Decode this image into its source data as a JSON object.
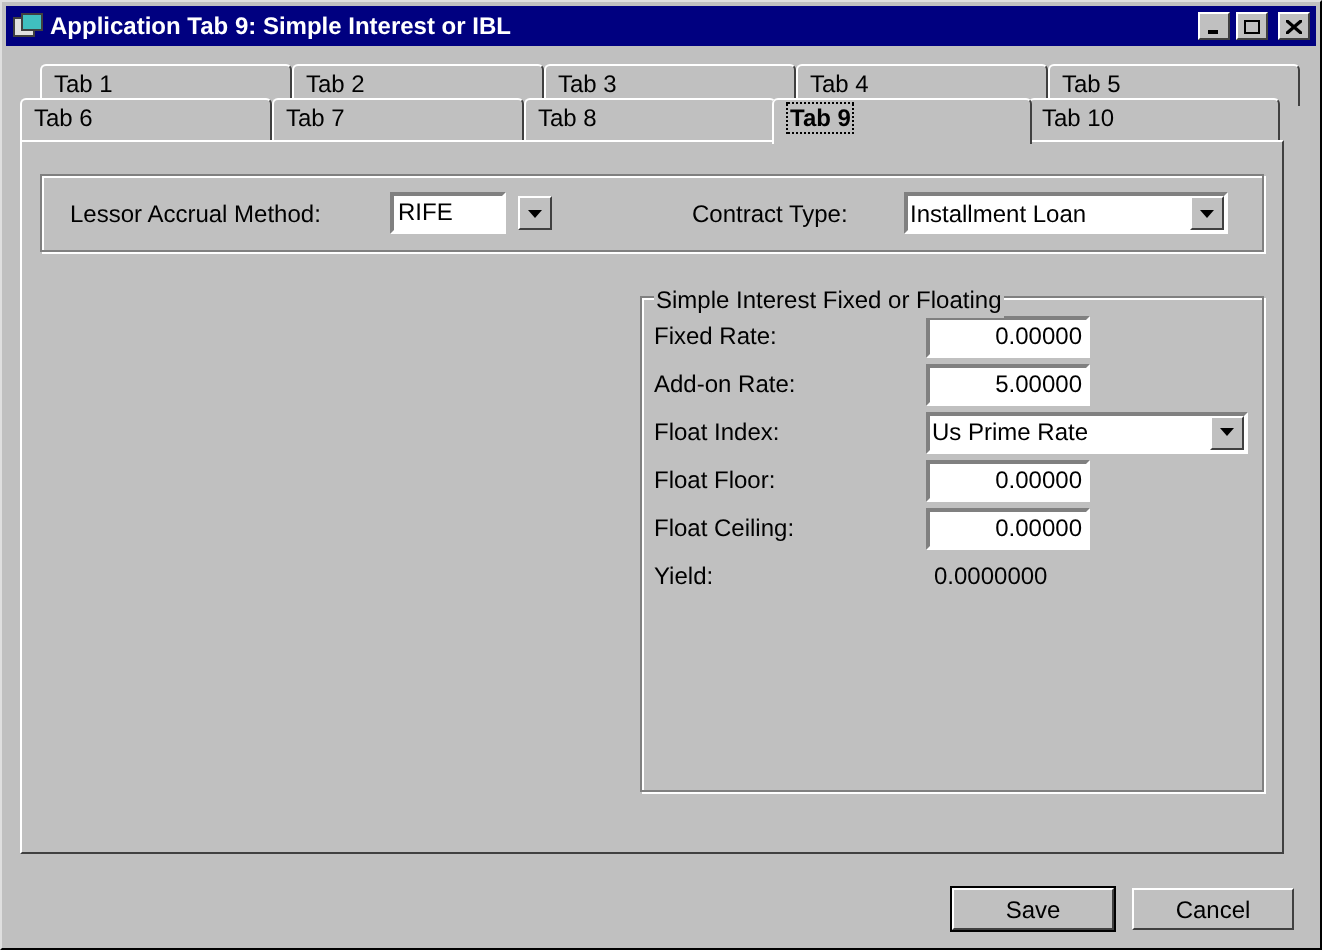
{
  "window": {
    "title": "Application Tab 9: Simple Interest or IBL"
  },
  "tab_rows": [
    [
      {
        "label": "Tab 1",
        "selected": false
      },
      {
        "label": "Tab 2",
        "selected": false
      },
      {
        "label": "Tab 3",
        "selected": false
      },
      {
        "label": "Tab 4",
        "selected": false
      },
      {
        "label": "Tab 5",
        "selected": false
      }
    ],
    [
      {
        "label": "Tab 6",
        "selected": false
      },
      {
        "label": "Tab 7",
        "selected": false
      },
      {
        "label": "Tab 8",
        "selected": false
      },
      {
        "label": "Tab 9",
        "selected": true
      },
      {
        "label": "Tab 10",
        "selected": false
      }
    ]
  ],
  "top_fields": [
    {
      "label": "Lessor Accrual Method:",
      "value": "RIFE"
    },
    {
      "label": "Contract Type:",
      "value": "Installment Loan"
    }
  ],
  "group": {
    "title": "Simple Interest Fixed or Floating",
    "rows": [
      {
        "kind": "number",
        "label": "Fixed Rate:",
        "value": "0.00000"
      },
      {
        "kind": "number",
        "label": "Add-on Rate:",
        "value": "5.00000"
      },
      {
        "kind": "dropdown",
        "label": "Float Index:",
        "value": "Us Prime Rate"
      },
      {
        "kind": "number",
        "label": "Float Floor:",
        "value": "0.00000"
      },
      {
        "kind": "number",
        "label": "Float Ceiling:",
        "value": "0.00000"
      },
      {
        "kind": "readout",
        "label": "Yield:",
        "value": "0.0000000"
      }
    ]
  },
  "buttons": [
    {
      "label": "Save",
      "default": true
    },
    {
      "label": "Cancel",
      "default": false
    }
  ]
}
